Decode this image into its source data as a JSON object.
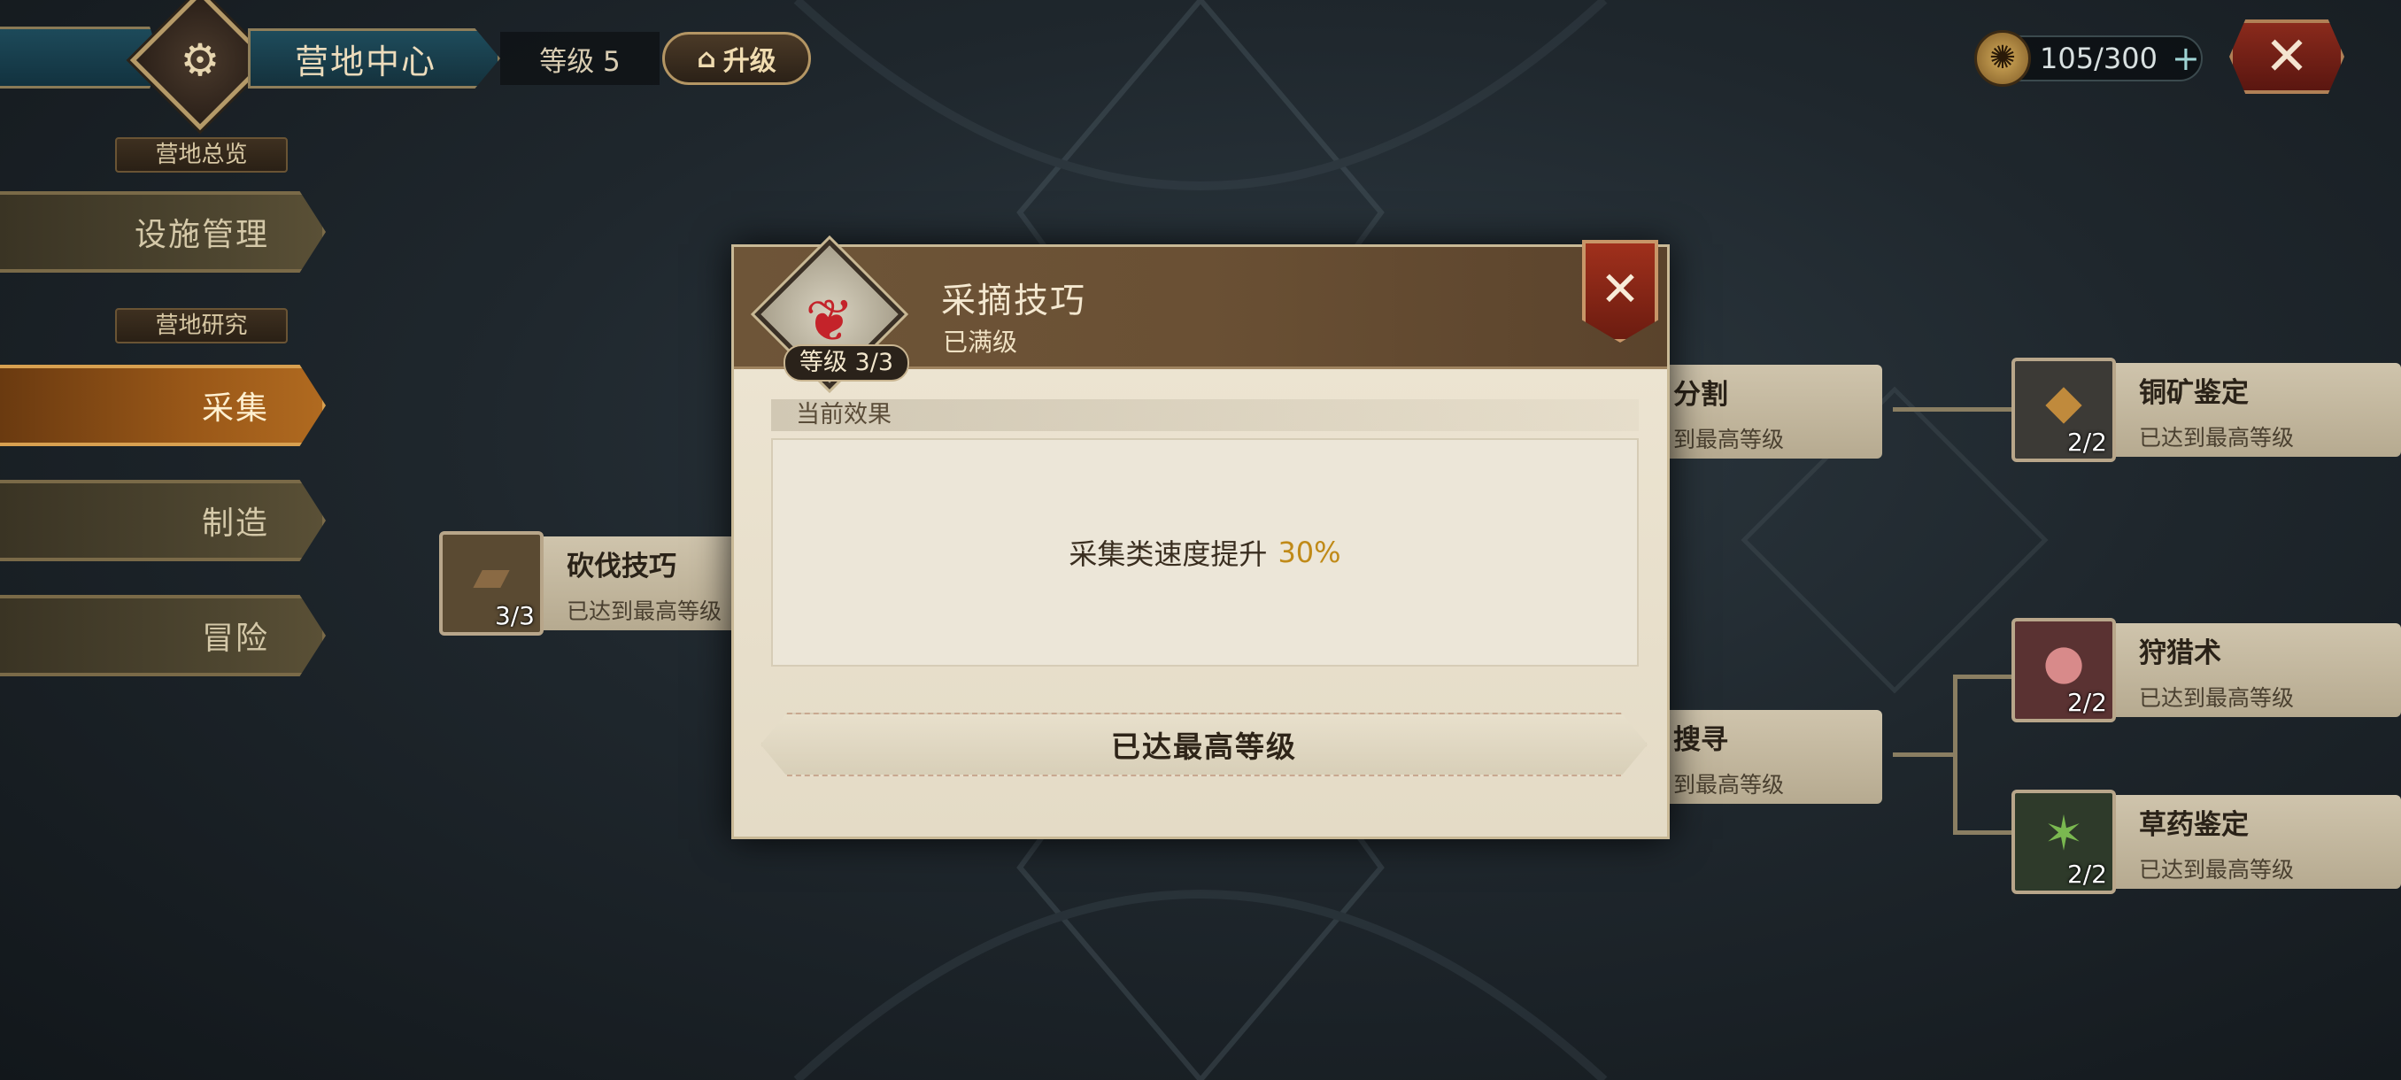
{
  "header": {
    "title": "营地中心",
    "level": "等级 5",
    "upgrade_label": "升级",
    "currency": "105/300",
    "currency_plus": "+",
    "close": "✕"
  },
  "sidebar": {
    "section_overview": "营地总览",
    "facility": "设施管理",
    "section_research": "营地研究",
    "items": [
      {
        "label": "采集",
        "active": true
      },
      {
        "label": "制造",
        "active": false
      },
      {
        "label": "冒险",
        "active": false
      }
    ]
  },
  "tree": {
    "logging": {
      "title": "砍伐技巧",
      "sub": "已达到最高等级",
      "count": "3/3"
    },
    "split_partial": {
      "title": "分割",
      "sub": "到最高等级"
    },
    "copper": {
      "title": "铜矿鉴定",
      "sub": "已达到最高等级",
      "count": "2/2"
    },
    "search_partial": {
      "title": "搜寻",
      "sub": "到最高等级"
    },
    "hunting": {
      "title": "狩猎术",
      "sub": "已达到最高等级",
      "count": "2/2"
    },
    "herb": {
      "title": "草药鉴定",
      "sub": "已达到最高等级",
      "count": "2/2"
    }
  },
  "modal": {
    "title": "采摘技巧",
    "subtitle": "已满级",
    "level_badge": "等级 3/3",
    "close": "✕",
    "effect_label": "当前效果",
    "effect_text": "采集类速度提升",
    "effect_value": "30%",
    "max_button": "已达最高等级"
  },
  "colors": {
    "accent_gold": "#c08a18",
    "active_tab": "#9a5818",
    "close_red": "#8a2a1c"
  },
  "icons": {
    "emblem": "camp-gear-icon",
    "currency": "coin-icon",
    "berry": "berry-icon",
    "log": "log-icon",
    "ore": "ore-icon",
    "meat": "meat-icon",
    "herb": "herb-icon"
  }
}
